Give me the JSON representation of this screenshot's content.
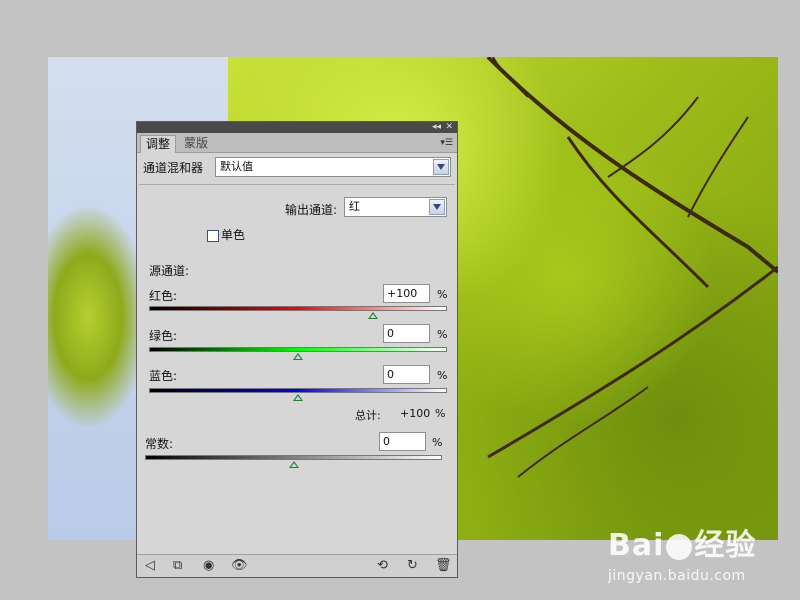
{
  "panel": {
    "tabs": [
      {
        "label": "调整",
        "active": true
      },
      {
        "label": "蒙版",
        "active": false
      }
    ],
    "title": "通道混和器",
    "preset": "默认值",
    "output_channel_label": "输出通道:",
    "output_channel_value": "红",
    "monochrome_label": "单色",
    "monochrome_checked": false,
    "source_channels_label": "源通道:",
    "channels": [
      {
        "label": "红色:",
        "value": "+100",
        "unit": "%",
        "slider_fraction": 0.75,
        "gradient": [
          "#000000",
          "#ff0000",
          "#ffffff"
        ]
      },
      {
        "label": "绿色:",
        "value": "0",
        "unit": "%",
        "slider_fraction": 0.5,
        "gradient": [
          "#000000",
          "#00ff00",
          "#ffffff"
        ]
      },
      {
        "label": "蓝色:",
        "value": "0",
        "unit": "%",
        "slider_fraction": 0.5,
        "gradient": [
          "#000000",
          "#0000ff",
          "#ffffff"
        ]
      }
    ],
    "total_label": "总计:",
    "total_value": "+100",
    "total_unit": "%",
    "constant_label": "常数:",
    "constant_value": "0",
    "constant_unit": "%",
    "constant_slider_fraction": 0.5
  },
  "footer_icons": [
    "back-arrow-icon",
    "clip-to-layer-icon",
    "visibility-toggle-icon",
    "eye-icon",
    "previous-state-icon",
    "reset-icon",
    "trash-icon"
  ],
  "watermark": {
    "logo_left": "Bai",
    "logo_right": "经验",
    "url": "jingyan.baidu.com"
  }
}
